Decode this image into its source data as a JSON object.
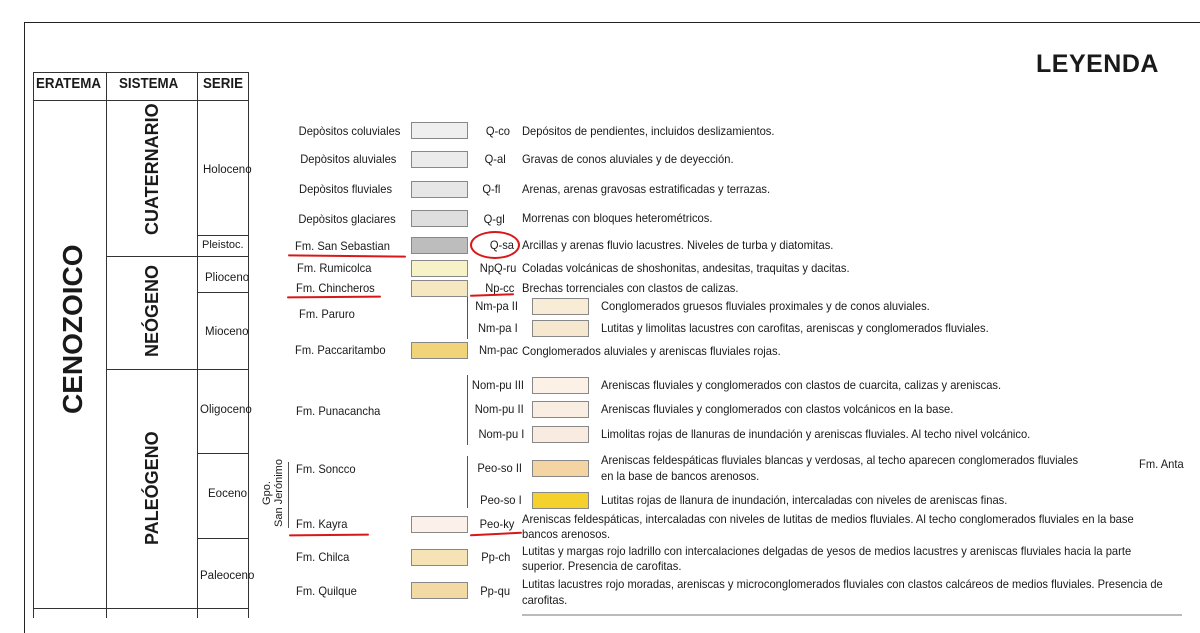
{
  "title": "LEYENDA",
  "headers": {
    "eratema": "ERATEMA",
    "sistema": "SISTEMA",
    "serie": "SERIE"
  },
  "eratema": "CENOZOICO",
  "sistemas": {
    "cuaternario": "CUATERNARIO",
    "neogeno": "NEÓGENO",
    "paleogeno": "PALEÓGENO"
  },
  "series": {
    "holoceno": "Holoceno",
    "pleistoceno": "Pleistoc.",
    "plioceno": "Plioceno",
    "mioceno": "Mioceno",
    "oligoceno": "Oligoceno",
    "eoceno": "Eoceno",
    "paleoceno": "Paleoceno"
  },
  "grupo": {
    "line1": "Gpo.",
    "line2": "San Jerónimo"
  },
  "side_label": "Fm. Anta",
  "units": [
    {
      "name": "Depòsitos coluviales",
      "code": "Q-co",
      "desc": "Depósitos de pendientes, incluidos deslizamientos.",
      "color": "#efefef"
    },
    {
      "name": "Depòsitos aluviales",
      "code": "Q-al",
      "desc": "Gravas de conos aluviales y de deyección.",
      "color": "#ebebeb"
    },
    {
      "name": "Depòsitos fluviales",
      "code": "Q-fl",
      "desc": "Arenas, arenas gravosas estratificadas y terrazas.",
      "color": "#e6e6e6"
    },
    {
      "name": "Depòsitos glaciares",
      "code": "Q-gl",
      "desc": "Morrenas con bloques heterométricos.",
      "color": "#dedede"
    },
    {
      "name": "Fm. San Sebastian",
      "code": "Q-sa",
      "desc": "Arcillas y arenas fluvio lacustres. Niveles de turba y diatomitas.",
      "color": "#bdbdbd"
    },
    {
      "name": "Fm. Rumicolca",
      "code": "NpQ-ru",
      "desc": "Coladas volcánicas de shoshonitas, andesitas, traquitas y dacitas.",
      "color": "#f7f3c6"
    },
    {
      "name": "Fm. Chincheros",
      "code": "Np-cc",
      "desc": "Brechas torrenciales con clastos de calizas.",
      "color": "#f5e7bf"
    },
    {
      "name": "Fm. Paruro",
      "code": "Nm-pa II",
      "desc": "Conglomerados gruesos fluviales proximales y de conos aluviales.",
      "color": "#f8ecd7"
    },
    {
      "name": "",
      "code": "Nm-pa I",
      "desc": "Lutitas y limolitas lacustres con carofitas, areniscas y conglomerados fluviales.",
      "color": "#f6e7cf"
    },
    {
      "name": "Fm. Paccaritambo",
      "code": "Nm-pac",
      "desc": "Conglomerados aluviales y areniscas fluviales rojas.",
      "color": "#f1d47a"
    },
    {
      "name": "Fm. Punacancha",
      "code": "Nom-pu III",
      "desc": "Areniscas fluviales y conglomerados con clastos de cuarcita, calizas y areniscas.",
      "color": "#fbf1e6"
    },
    {
      "name": "",
      "code": "Nom-pu II",
      "desc": "Areniscas fluviales y conglomerados con clastos volcánicos en la base.",
      "color": "#faeee3"
    },
    {
      "name": "",
      "code": "Nom-pu I",
      "desc": "Limolitas rojas de llanuras de inundación y areniscas fluviales. Al techo nivel volcánico.",
      "color": "#f9ebe0"
    },
    {
      "name": "Fm. Soncco",
      "code": "Peo-so II",
      "desc": "Areniscas feldespáticas  fluviales blancas y verdosas, al techo aparecen conglomerados fluviales",
      "desc2": "en la base de bancos arenosos.",
      "color": "#f5d4a4"
    },
    {
      "name": "",
      "code": "Peo-so I",
      "desc": "Lutitas rojas de llanura de inundación, intercaladas con niveles de areniscas finas.",
      "color": "#f4d12c"
    },
    {
      "name": "Fm. Kayra",
      "code": "Peo-ky",
      "desc": "Areniscas feldespáticas, intercaladas con niveles de lutitas de medios fluviales. Al techo conglomerados fluviales en la base",
      "desc2": "bancos arenosos.",
      "color": "#fbf0ea"
    },
    {
      "name": "Fm. Chilca",
      "code": "Pp-ch",
      "desc": "Lutitas y margas rojo ladrillo con intercalaciones delgadas de yesos de medios lacustres y areniscas fluviales hacia la parte",
      "desc2": "superior. Presencia de carofitas.",
      "color": "#f5e3b6"
    },
    {
      "name": "Fm. Quilque",
      "code": "Pp-qu",
      "desc": "Lutitas lacustres rojo moradas, areniscas y microconglomerados fluviales con clastos calcáreos de medios fluviales. Presencia de",
      "desc2": "carofitas.",
      "color": "#f3d9a4"
    }
  ],
  "colors": {
    "annotation_red": "#d81818"
  }
}
